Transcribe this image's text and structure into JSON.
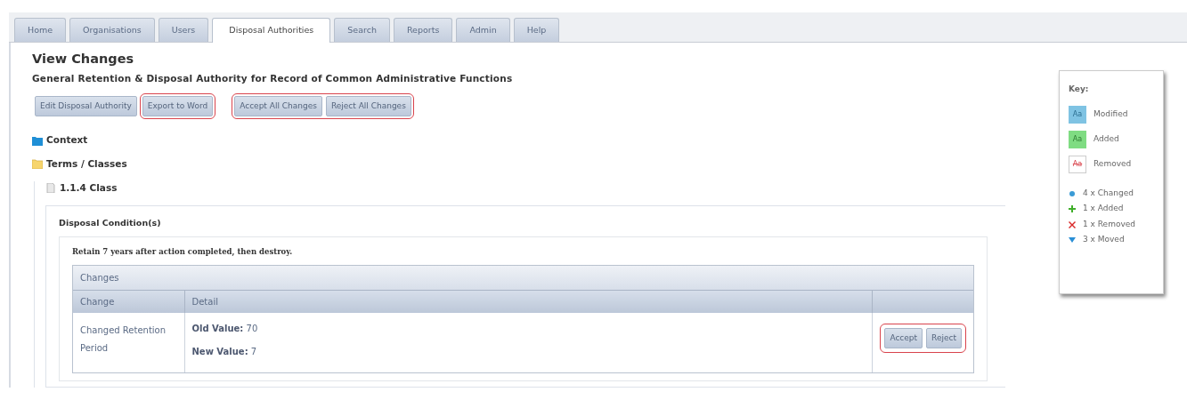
{
  "tabs": [
    {
      "label": "Home",
      "selected": false
    },
    {
      "label": "Organisations",
      "selected": false
    },
    {
      "label": "Users",
      "selected": false
    },
    {
      "label": "Disposal Authorities",
      "selected": true
    },
    {
      "label": "Search",
      "selected": false
    },
    {
      "label": "Reports",
      "selected": false
    },
    {
      "label": "Admin",
      "selected": false
    },
    {
      "label": "Help",
      "selected": false
    }
  ],
  "page": {
    "title": "View Changes",
    "subtitle": "General Retention & Disposal Authority for Record of Common Administrative Functions"
  },
  "toolbar": [
    {
      "highlighted": false,
      "buttons": [
        "Edit Disposal Authority"
      ]
    },
    {
      "highlighted": true,
      "buttons": [
        "Export to Word"
      ]
    },
    {
      "highlighted": true,
      "buttons": [
        "Accept All Changes",
        "Reject All Changes"
      ]
    }
  ],
  "tree": [
    {
      "label": "Context",
      "kind": "folder-blue"
    },
    {
      "label": "Terms / Classes",
      "kind": "folder-yellow",
      "children": [
        {
          "label": "1.1.4 Class",
          "kind": "file"
        }
      ]
    }
  ],
  "section": {
    "title": "Disposal Condition(s)",
    "condition": "Retain 7 years after action completed, then destroy.",
    "table": {
      "caption": "Changes",
      "columns": [
        "Change",
        "Detail"
      ],
      "rows": [
        {
          "change": "Changed Retention Period",
          "details": [
            {
              "label": "Old Value:",
              "value": "70"
            },
            {
              "label": "New Value:",
              "value": "7"
            }
          ],
          "actions": {
            "highlighted": true,
            "buttons": [
              "Accept",
              "Reject"
            ]
          }
        }
      ]
    }
  },
  "key": {
    "title": "Key:",
    "styles": [
      {
        "sample": "Aa",
        "label": "Modified",
        "kind": "modified"
      },
      {
        "sample": "Aa",
        "label": "Added",
        "kind": "added"
      },
      {
        "sample": "Aa",
        "label": "Removed",
        "kind": "removed"
      }
    ],
    "counts": [
      {
        "label": "4 x Changed",
        "kind": "changed"
      },
      {
        "label": "1 x Added",
        "kind": "added"
      },
      {
        "label": "1 x Removed",
        "kind": "removed"
      },
      {
        "label": "3 x Moved",
        "kind": "moved"
      }
    ]
  }
}
